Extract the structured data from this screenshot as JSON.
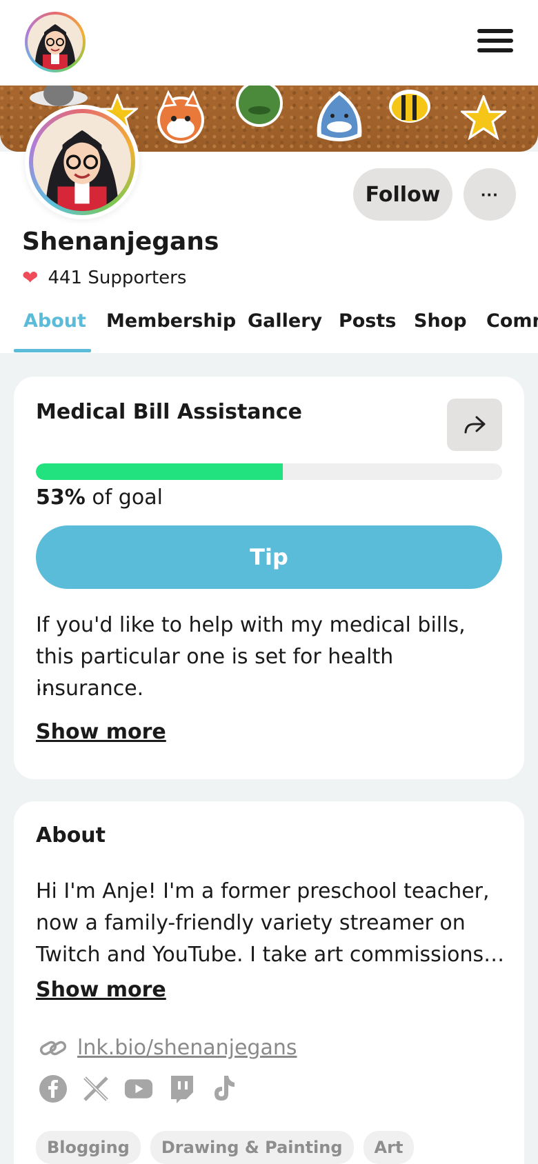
{
  "creator": {
    "name": "Shenanjegans",
    "supporters": "441 Supporters"
  },
  "actions": {
    "follow_label": "Follow",
    "more_label": "···"
  },
  "tabs": [
    {
      "label": "About",
      "active": true
    },
    {
      "label": "Membership"
    },
    {
      "label": "Gallery"
    },
    {
      "label": "Posts"
    },
    {
      "label": "Shop"
    },
    {
      "label": "Community"
    }
  ],
  "goal": {
    "title": "Medical Bill Assistance",
    "percent_label": "53%",
    "of_goal": "of goal",
    "progress_fraction": 0.53,
    "tip_label": "Tip",
    "description": "If you'd like to help with my medical bills, this particular one is set for health insurance.",
    "ellipsis": "...",
    "show_more": "Show more"
  },
  "about": {
    "title": "About",
    "text": "Hi I'm Anje! I'm a former preschool teacher, now a family-friendly variety streamer on Twitch and YouTube. I take art commissions…",
    "show_more": "Show more",
    "link": "lnk.bio/shenanjegans",
    "socials": [
      "facebook-icon",
      "x-icon",
      "youtube-icon",
      "twitch-icon",
      "tiktok-icon"
    ],
    "tags": [
      "Blogging",
      "Drawing & Painting",
      "Art"
    ]
  },
  "colors": {
    "accent": "#5bbcd9",
    "progress": "#22e27f",
    "heart": "#ef4b58"
  }
}
